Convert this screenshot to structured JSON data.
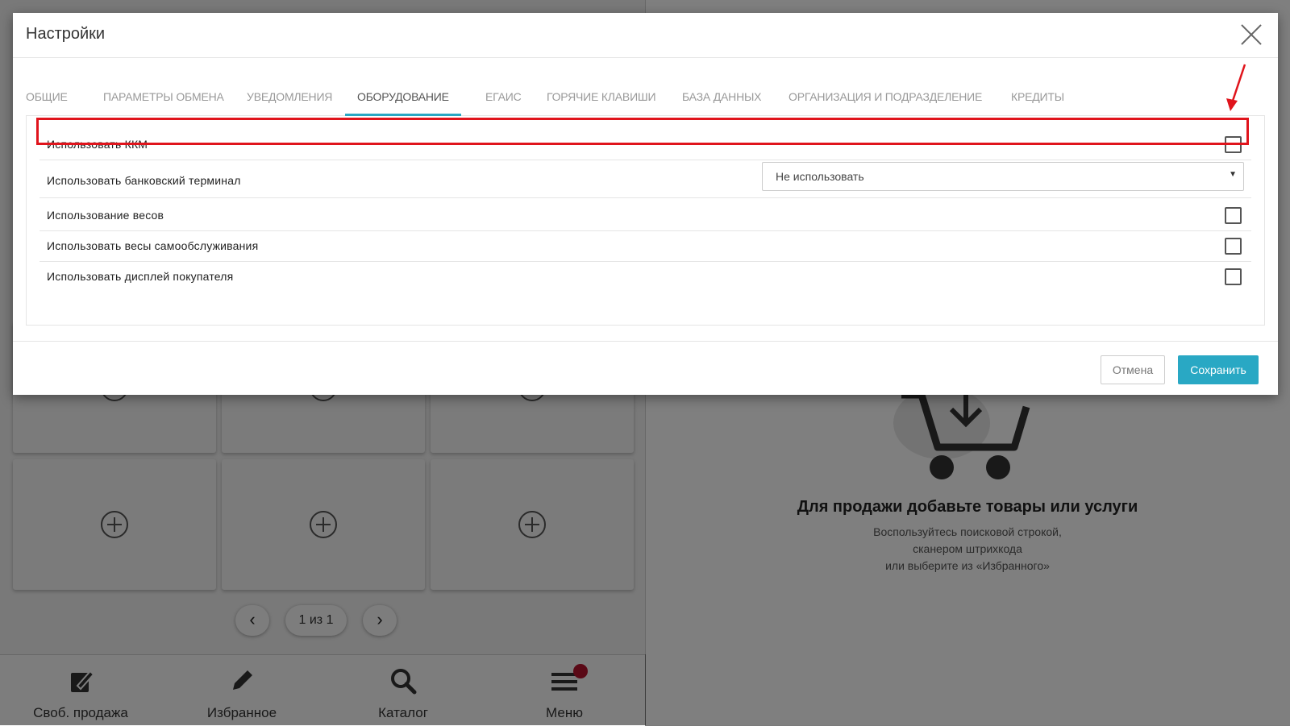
{
  "background": {
    "pager": {
      "label": "1 из 1"
    },
    "bottom_nav": [
      {
        "label": "Своб. продажа",
        "icon": "free-sale-icon"
      },
      {
        "label": "Избранное",
        "icon": "pencil-icon"
      },
      {
        "label": "Каталог",
        "icon": "search-icon"
      },
      {
        "label": "Меню",
        "icon": "menu-icon"
      }
    ],
    "empty_cart": {
      "title": "Для продажи добавьте товары или услуги",
      "lines": [
        "Воспользуйтесь поисковой строкой,",
        "сканером штрихкода",
        "или выберите из «Избранного»"
      ]
    }
  },
  "modal": {
    "title": "Настройки",
    "tabs": [
      {
        "label": "ОБЩИЕ"
      },
      {
        "label": "ПАРАМЕТРЫ ОБМЕНА"
      },
      {
        "label": "УВЕДОМЛЕНИЯ"
      },
      {
        "label": "ОБОРУДОВАНИЕ",
        "active": true
      },
      {
        "label": "ЕГАИС"
      },
      {
        "label": "ГОРЯЧИЕ КЛАВИШИ"
      },
      {
        "label": "БАЗА ДАННЫХ"
      },
      {
        "label": "ОРГАНИЗАЦИЯ И ПОДРАЗДЕЛЕНИЕ"
      },
      {
        "label": "КРЕДИТЫ"
      }
    ],
    "rows": {
      "use_kkm": {
        "label": "Использовать ККМ",
        "checked": false
      },
      "bank_terminal": {
        "label": "Использовать банковский терминал",
        "selected": "Не использовать"
      },
      "scales": {
        "label": "Использование весов",
        "checked": false
      },
      "self_service_scales": {
        "label": "Использовать весы самообслуживания",
        "checked": false
      },
      "customer_display": {
        "label": "Использовать дисплей покупателя",
        "checked": false
      }
    },
    "footer": {
      "cancel_label": "Отмена",
      "save_label": "Сохранить"
    }
  },
  "colors": {
    "accent": "#29a8c4",
    "highlight": "#e0141c",
    "badge": "#b5122c"
  }
}
